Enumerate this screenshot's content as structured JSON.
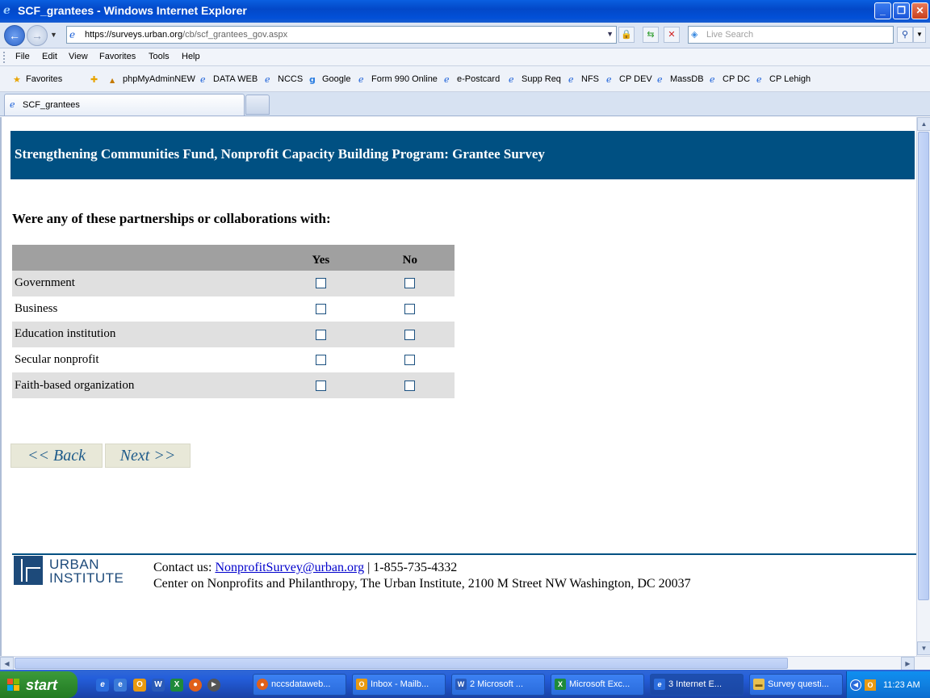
{
  "window": {
    "title": "SCF_grantees - Windows Internet Explorer"
  },
  "address": {
    "url_prefix": "https://surveys.",
    "url_domain": "urban.org",
    "url_path": "/cb/scf_grantees_gov.aspx",
    "search_placeholder": "Live Search"
  },
  "menu": [
    "File",
    "Edit",
    "View",
    "Favorites",
    "Tools",
    "Help"
  ],
  "favorites": {
    "label": "Favorites",
    "items": [
      "phpMyAdminNEW",
      "DATA WEB",
      "NCCS",
      "Google",
      "Form 990 Online",
      "e-Postcard",
      "Supp Req",
      "NFS",
      "CP DEV",
      "MassDB",
      "CP DC",
      "CP Lehigh"
    ]
  },
  "tab": {
    "label": "SCF_grantees"
  },
  "page": {
    "banner": "Strengthening Communities Fund, Nonprofit Capacity Building Program: Grantee Survey",
    "question": "Were any of these partnerships or collaborations with:",
    "columns": [
      "Yes",
      "No"
    ],
    "rows": [
      "Government",
      "Business",
      "Education institution",
      "Secular nonprofit",
      "Faith-based organization"
    ],
    "back_label": "<< Back",
    "next_label": "Next >>"
  },
  "footer": {
    "logo_line1": "URBAN",
    "logo_line2": "INSTITUTE",
    "contact_label": "Contact us:",
    "email": "NonprofitSurvey@urban.org",
    "phone": "| 1-855-735-4332",
    "address": "Center on Nonprofits and Philanthropy, The Urban Institute, 2100 M Street NW Washington, DC 20037"
  },
  "taskbar": {
    "start": "start",
    "tasks": [
      "nccsdataweb...",
      "Inbox - Mailb...",
      "2 Microsoft ...",
      "Microsoft Exc...",
      "3 Internet E...",
      "Survey questi..."
    ],
    "clock": "11:23 AM"
  }
}
